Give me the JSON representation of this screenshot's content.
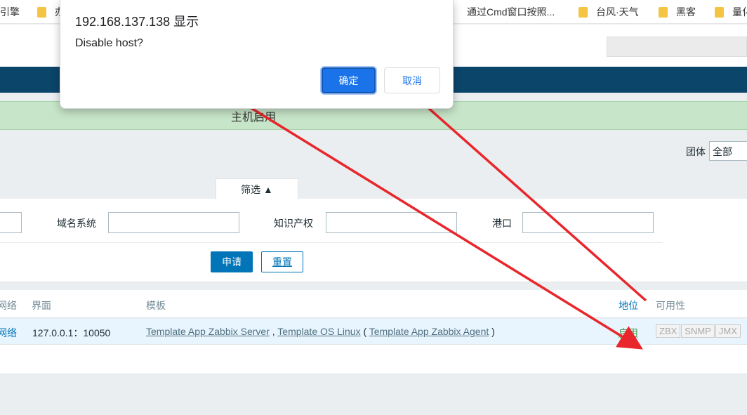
{
  "bookmarks": {
    "item1": "引擎",
    "item2": "办",
    "item3": "通过Cmd窗口按照...",
    "item4": "台风·天气",
    "item5": "黑客",
    "item6": "量化"
  },
  "message_bar": {
    "text": "主机启用"
  },
  "group": {
    "label": "团体",
    "selected": "全部"
  },
  "filter": {
    "tab_label": "筛选 ▲",
    "dns_label": "域名系统",
    "ip_label": "知识产权",
    "port_label": "港口",
    "apply_label": "申请",
    "reset_label": "重置"
  },
  "table": {
    "headers": {
      "network": "网络",
      "interface": "界面",
      "templates": "模板",
      "status": "地位",
      "availability": "可用性"
    },
    "row": {
      "network": "网络",
      "interface": "127.0.0.1：10050",
      "template1": "Template App Zabbix Server",
      "sep1": " , ",
      "template2": "Template OS Linux",
      "sep2": " ( ",
      "template3": "Template App Zabbix Agent",
      "sep3": " )",
      "status": "启用",
      "avail": [
        "ZBX",
        "SNMP",
        "JMX"
      ]
    }
  },
  "dialog": {
    "title": "192.168.137.138 显示",
    "message": "Disable host?",
    "ok_label": "确定",
    "cancel_label": "取消"
  },
  "colors": {
    "navbar": "#0b456a",
    "message_bar": "#c7e5c8",
    "link": "#0275b8",
    "enabled": "#429e47",
    "annotation_arrow": "#e8262b"
  }
}
